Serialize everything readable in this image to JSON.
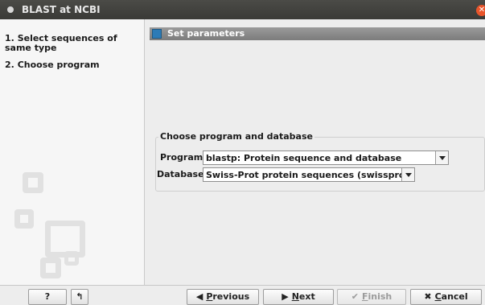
{
  "window": {
    "title": "BLAST at NCBI"
  },
  "steps": [
    {
      "number": "1.",
      "label": "Select sequences of same type"
    },
    {
      "number": "2.",
      "label": "Choose program"
    }
  ],
  "section": {
    "title": "Set parameters"
  },
  "group": {
    "title": "Choose program and database",
    "program_label": "Program:",
    "program_value": "blastp: Protein sequence and database",
    "database_label": "Database",
    "database_value": "Swiss-Prot protein sequences (swissprot)"
  },
  "buttons": {
    "help": "?",
    "reset": "↰",
    "previous_first": "P",
    "previous_rest": "revious",
    "next_first": "N",
    "next_rest": "ext",
    "finish_first": "F",
    "finish_rest": "inish",
    "cancel_first": "C",
    "cancel_rest": "ancel"
  }
}
